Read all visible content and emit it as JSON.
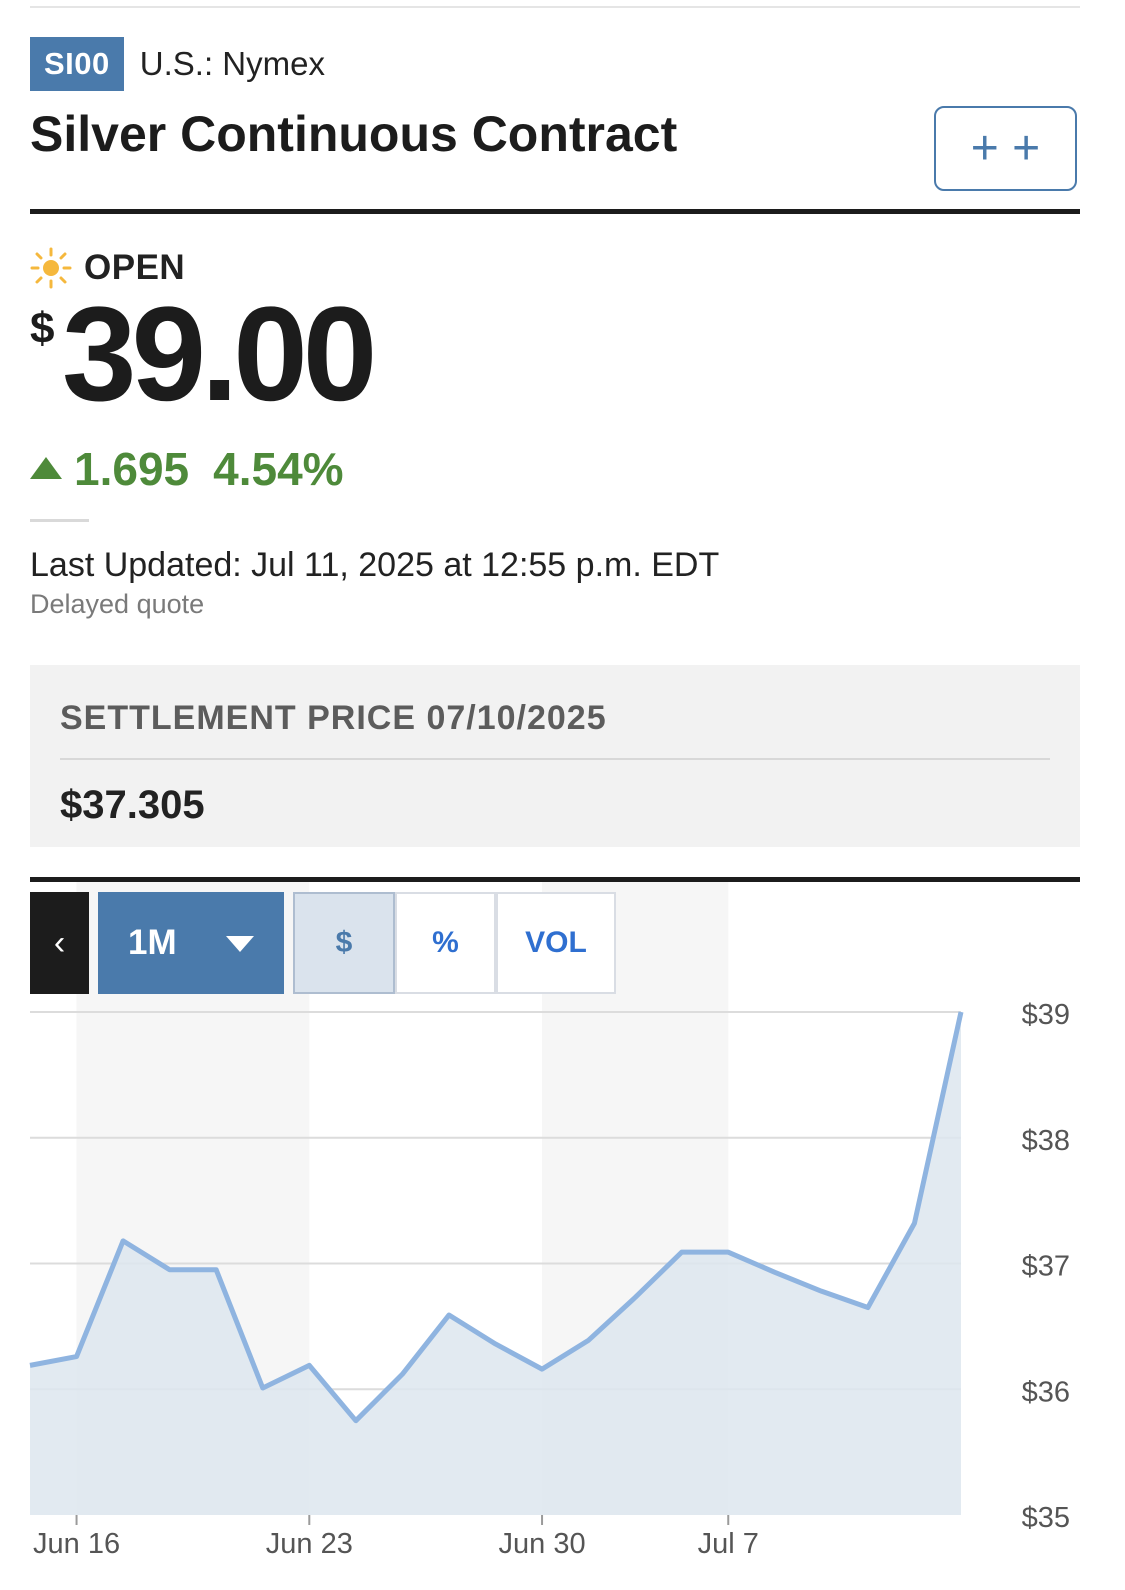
{
  "quote": {
    "ticker": "SI00",
    "exchange": "U.S.: Nymex",
    "title": "Silver Continuous Contract",
    "add_button_label": "+ +",
    "market_status": "OPEN",
    "currency_symbol": "$",
    "price": "39.00",
    "change": "1.695",
    "change_percent": "4.54%",
    "last_updated": "Last Updated: Jul 11, 2025 at 12:55 p.m. EDT",
    "delayed_note": "Delayed quote",
    "settlement_label": "SETTLEMENT PRICE 07/10/2025",
    "settlement_value": "$37.305"
  },
  "chart_controls": {
    "back_label": "‹",
    "range_label": "1M",
    "mode_dollar": "$",
    "mode_percent": "%",
    "mode_volume": "VOL"
  },
  "colors": {
    "accent": "#4a7aab",
    "positive": "#4e8a3a",
    "line": "#8fb4e0",
    "fill": "#dde6ef"
  },
  "chart_data": {
    "type": "area",
    "x": [
      "Jun 13",
      "Jun 16",
      "Jun 17",
      "Jun 18",
      "Jun 19",
      "Jun 20",
      "Jun 23",
      "Jun 24",
      "Jun 25",
      "Jun 26",
      "Jun 27",
      "Jun 30",
      "Jul 1",
      "Jul 2",
      "Jul 3",
      "Jul 7",
      "Jul 8",
      "Jul 9",
      "Jul 10",
      "Jul 11",
      "Jul 11 close"
    ],
    "values": [
      36.19,
      36.26,
      37.18,
      36.95,
      36.95,
      36.01,
      36.19,
      35.75,
      36.12,
      36.59,
      36.36,
      36.16,
      36.39,
      36.73,
      37.09,
      37.09,
      36.93,
      36.78,
      36.65,
      37.32,
      39.0
    ],
    "x_ticks": [
      "Jun 16",
      "Jun 23",
      "Jun 30",
      "Jul 7"
    ],
    "y_ticks": [
      "$39",
      "$38",
      "$37",
      "$36",
      "$35"
    ],
    "ylim": [
      35,
      39
    ],
    "grid": true
  }
}
